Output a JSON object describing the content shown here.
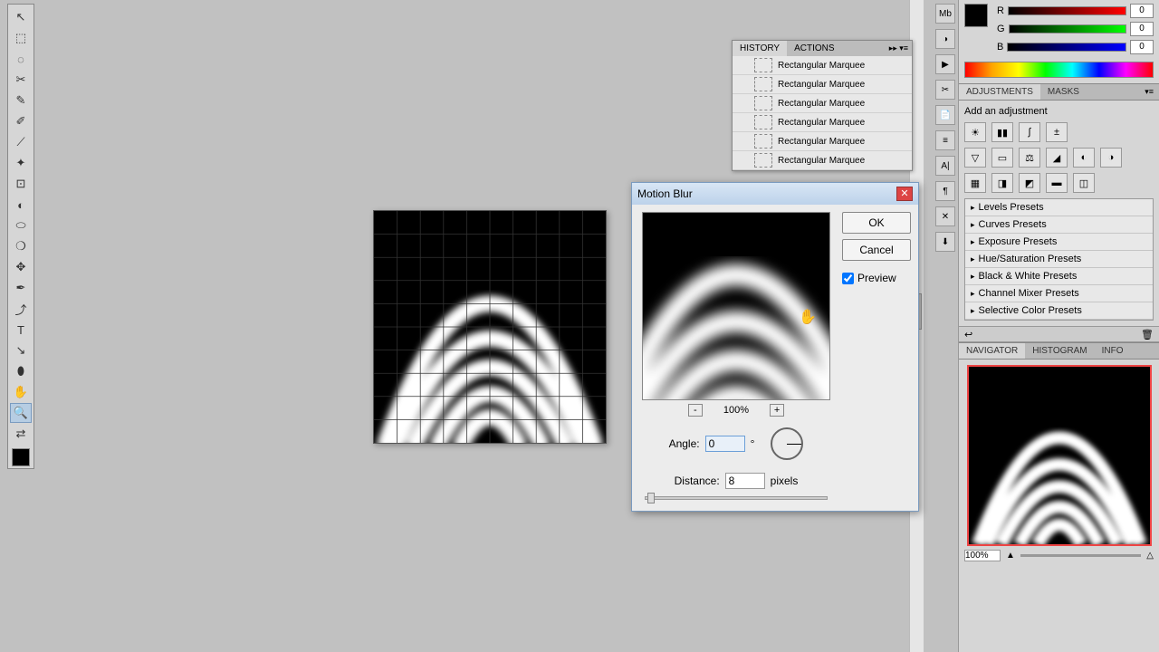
{
  "tools": [
    "↖",
    "⬚",
    "◌",
    "✂",
    "✎",
    "✐",
    "⟋",
    "✦",
    "⊡",
    "◐",
    "⬭",
    "❍",
    "✥",
    "✒",
    "⤴",
    "T",
    "↘",
    "⬮",
    "✋",
    "🔍",
    "⇄"
  ],
  "dialog": {
    "title": "Motion Blur",
    "ok": "OK",
    "cancel": "Cancel",
    "preview": "Preview",
    "zoom": "100%",
    "angle_label": "Angle:",
    "angle_value": "0",
    "angle_unit": "°",
    "distance_label": "Distance:",
    "distance_value": "8",
    "distance_unit": "pixels",
    "minus": "-",
    "plus": "+"
  },
  "history": {
    "tab1": "HISTORY",
    "tab2": "ACTIONS",
    "items": [
      "Rectangular Marquee",
      "Rectangular Marquee",
      "Rectangular Marquee",
      "Rectangular Marquee",
      "Rectangular Marquee",
      "Rectangular Marquee"
    ]
  },
  "color": {
    "r_label": "R",
    "g_label": "G",
    "b_label": "B",
    "r": "0",
    "g": "0",
    "b": "0"
  },
  "adjustments": {
    "tab1": "ADJUSTMENTS",
    "tab2": "MASKS",
    "heading": "Add an adjustment",
    "presets": [
      "Levels Presets",
      "Curves Presets",
      "Exposure Presets",
      "Hue/Saturation Presets",
      "Black & White Presets",
      "Channel Mixer Presets",
      "Selective Color Presets"
    ]
  },
  "navigator": {
    "tab1": "NAVIGATOR",
    "tab2": "HISTOGRAM",
    "tab3": "INFO",
    "zoom": "100%"
  }
}
